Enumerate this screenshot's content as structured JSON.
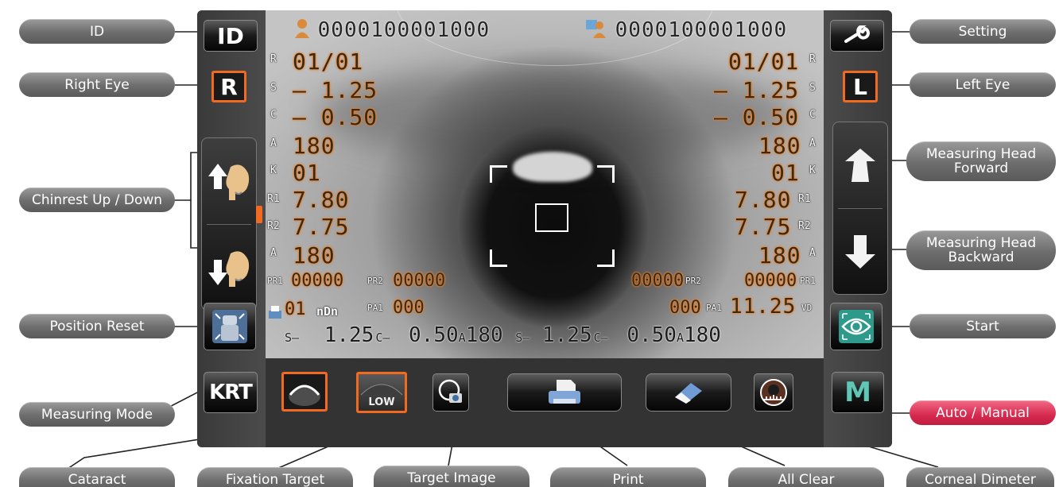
{
  "callouts": {
    "id": "ID",
    "right_eye": "Right Eye",
    "chinrest": "Chinrest Up / Down",
    "position_reset": "Position Reset",
    "measuring_mode": "Measuring Mode",
    "cataract": "Cataract",
    "fixation_target": "Fixation Target",
    "target_image": "Target Image",
    "print": "Print",
    "all_clear": "All Clear",
    "corneal_dimeter": "Corneal Dimeter",
    "setting": "Setting",
    "left_eye": "Left Eye",
    "head_forward_line1": "Measuring Head",
    "head_forward_line2": "Forward",
    "head_backward_line1": "Measuring Head",
    "head_backward_line2": "Backward",
    "start": "Start",
    "auto_manual": "Auto / Manual"
  },
  "screen": {
    "patient_id": "0000100001000",
    "operator_id": "0000100001000",
    "buttons": {
      "id": "ID",
      "right": "R",
      "left": "L",
      "mode": "KRT",
      "auto_manual": "M",
      "fixation_low": "LOW"
    },
    "labels": {
      "r": "R",
      "s": "S",
      "c": "C",
      "a": "A",
      "k": "K",
      "r1": "R1",
      "r2": "R2",
      "a2": "A",
      "pr1": "PR1",
      "pr2": "PR2",
      "pa1": "PA1",
      "vd": "VD",
      "mm_icon": "nDn"
    },
    "right_eye": {
      "r": "01/01",
      "s": "– 1.25",
      "c": "– 0.50",
      "a": "180",
      "k": "01",
      "r1": "7.80",
      "r2": "7.75",
      "a2": "180",
      "pr1": "00000",
      "pr2": "00000",
      "pa1": "000",
      "mm": "01"
    },
    "left_eye": {
      "r": "01/01",
      "s": "– 1.25",
      "c": "– 0.50",
      "a": "180",
      "k": "01",
      "r1": "7.80",
      "r2": "7.75",
      "a2": "180",
      "pr1": "00000",
      "pr2": "00000",
      "pa1": "000",
      "vd": "11.25"
    },
    "summary": {
      "s1_label": "S–",
      "s1": "1.25",
      "c1_label": "C–",
      "c1": "0.50",
      "a1_label": "A",
      "a1": "180",
      "s2_label": "S–",
      "s2": "1.25",
      "c2_label": "C–",
      "c2": "0.50",
      "a2_label": "A",
      "a2": "180"
    }
  },
  "colors": {
    "accent_orange": "#f26a1f",
    "callout_gray": "#6d6d6d",
    "callout_red": "#d62a4f",
    "start_teal": "#2e9a8c"
  }
}
